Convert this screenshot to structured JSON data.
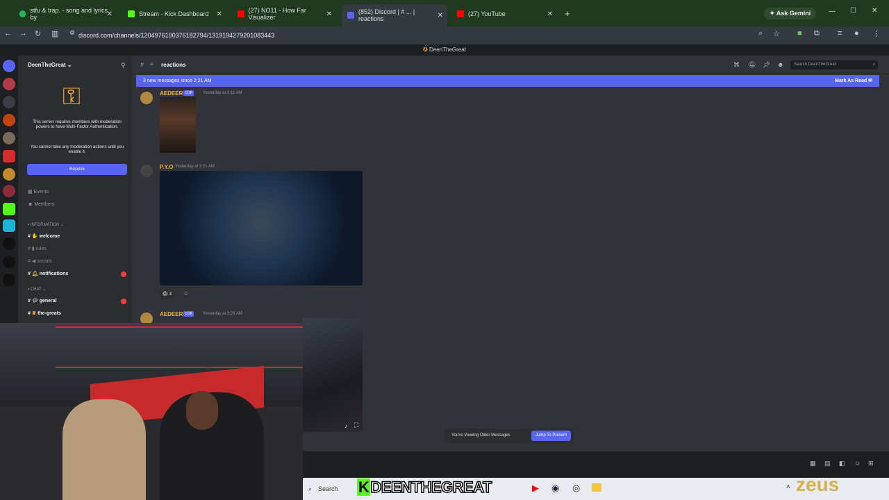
{
  "browser": {
    "tabs": [
      {
        "title": "stfu & trap. - song and lyrics by",
        "color": "#1db954"
      },
      {
        "title": "Stream - Kick Dashboard",
        "color": "#53fc18"
      },
      {
        "title": "(27) NO11 - How Far Visualizer",
        "color": "#ff0000"
      },
      {
        "title": "(852) Discord | # ... | reactions",
        "color": "#5865f2"
      },
      {
        "title": "(27) YouTube",
        "color": "#ff0000"
      }
    ],
    "url": "discord.com/channels/1204976100376182794/1319194279201083443",
    "gemini": "Ask Gemini"
  },
  "discord": {
    "window_title": "DeenTheGreat",
    "server_name": "DeenTheGreat",
    "mfa_text": "This server requires members with moderation powers to have Multi-Factor Authentication.",
    "mfa_text2": "You cannot take any moderation actions until you enable it.",
    "resolve": "Resolve",
    "nav": [
      "Events",
      "Members"
    ],
    "categories": {
      "info": "INFORMATION",
      "chat": "CHAT"
    },
    "channels": [
      {
        "name": "welcome",
        "bold": true
      },
      {
        "name": "rules",
        "bold": false
      },
      {
        "name": "socials",
        "bold": false
      },
      {
        "name": "notifications",
        "bold": true
      },
      {
        "name": "general",
        "bold": true
      },
      {
        "name": "the-greats",
        "bold": true
      }
    ],
    "channel_title": "reactions",
    "search_placeholder": "Search DeenTheGreat",
    "banner": "3 new messages since 2:21 AM",
    "mark_read": "Mark As Read",
    "messages": [
      {
        "user": "AEDEER",
        "tag": "COB",
        "time": "Yesterday at 3:11 AM"
      },
      {
        "user": "P.Y.O",
        "tag": "",
        "time": "Yesterday at 3:21 AM"
      },
      {
        "user": "AEDEER",
        "tag": "COB",
        "time": "Yesterday at 3:26 AM"
      }
    ],
    "reaction_count": "3",
    "older": "You're Viewing Older Messages",
    "jump": "Jump To Present"
  },
  "taskbar": {
    "search": "Search",
    "overlay": "DEENTHEGREAT",
    "brand": "zeus"
  }
}
